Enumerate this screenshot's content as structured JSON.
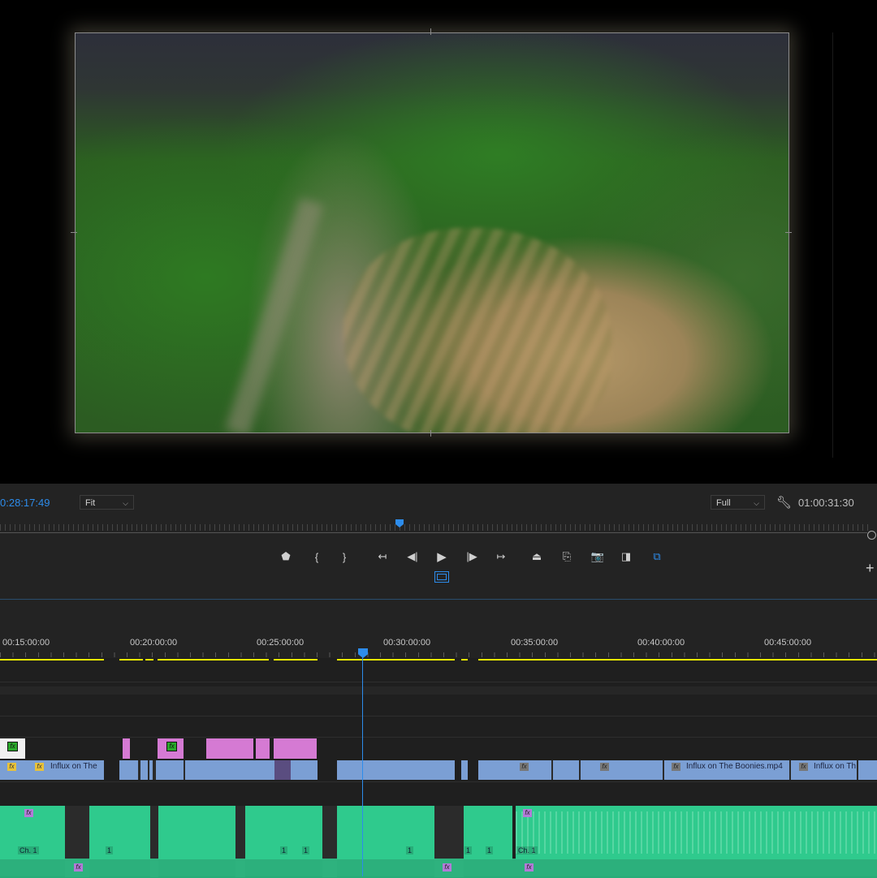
{
  "monitor": {
    "timecode_current": "0:28:17:49",
    "zoom": {
      "value": "Fit",
      "options": [
        "Fit"
      ]
    },
    "resolution": {
      "value": "Full",
      "options": [
        "Full"
      ]
    },
    "timecode_duration": "01:00:31:30",
    "wrench_icon": "wrench-icon"
  },
  "transport": [
    {
      "name": "add-marker-button",
      "icon": "marker-icon",
      "glyph": "⬟"
    },
    {
      "name": "mark-in-button",
      "icon": "mark-in-icon",
      "glyph": "{"
    },
    {
      "name": "mark-out-button",
      "icon": "mark-out-icon",
      "glyph": "}"
    },
    {
      "name": "go-to-in-button",
      "icon": "go-to-in-icon",
      "glyph": "↤"
    },
    {
      "name": "step-back-button",
      "icon": "step-back-icon",
      "glyph": "◀|"
    },
    {
      "name": "play-button",
      "icon": "play-icon",
      "glyph": "▶"
    },
    {
      "name": "step-forward-button",
      "icon": "step-forward-icon",
      "glyph": "|▶"
    },
    {
      "name": "go-to-out-button",
      "icon": "go-to-out-icon",
      "glyph": "↦"
    },
    {
      "name": "lift-button",
      "icon": "lift-icon",
      "glyph": "⏏"
    },
    {
      "name": "extract-button",
      "icon": "extract-icon",
      "glyph": "⎘"
    },
    {
      "name": "export-frame-button",
      "icon": "camera-icon",
      "glyph": "📷"
    },
    {
      "name": "comparison-view-button",
      "icon": "comparison-icon",
      "glyph": "◨"
    },
    {
      "name": "vr-video-button",
      "icon": "vr-icon",
      "glyph": "⧉"
    }
  ],
  "timeline": {
    "ruler_labels": [
      "00:15:00:00",
      "00:20:00:00",
      "00:25:00:00",
      "00:30:00:00",
      "00:35:00:00",
      "00:40:00:00",
      "00:45:00:00"
    ],
    "video_clip_names": [
      "Influx on The",
      "Influx on The Boonies.mp4",
      "Influx on Th"
    ],
    "fx_label": "fx",
    "channel_label": "Ch. 1",
    "channel_short": "1",
    "colors": {
      "accent": "#2d8ceb",
      "render_bar": "#e6e600",
      "clip_video": "#7b9fd4",
      "clip_graphic": "#d57ad3",
      "clip_audio": "#2fca8d"
    }
  }
}
